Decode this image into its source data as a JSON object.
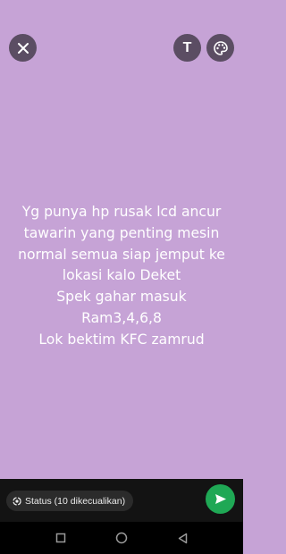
{
  "status_text": "Yg punya hp rusak lcd ancur\ntawarin yang penting mesin\nnormal semua siap jemput ke\nlokasi kalo Deket\nSpek gahar masuk\nRam3,4,6,8\nLok bektim KFC zamrud",
  "toolbar": {
    "text_tool_label": "T",
    "icons": {
      "close": "close-icon",
      "text": "text-format-icon",
      "palette": "palette-icon"
    }
  },
  "audience": {
    "label": "Status (10 dikecualikan)",
    "icon": "status-circle-icon"
  },
  "send": {
    "icon": "send-arrow-icon"
  },
  "navigation": {
    "icons": [
      "recent-apps-icon",
      "home-icon",
      "back-icon"
    ]
  },
  "colors": {
    "background": "#c6a3d6",
    "button_dark": "#5b4d63",
    "bottom_bar": "#131313",
    "send_green": "#1fa855"
  }
}
